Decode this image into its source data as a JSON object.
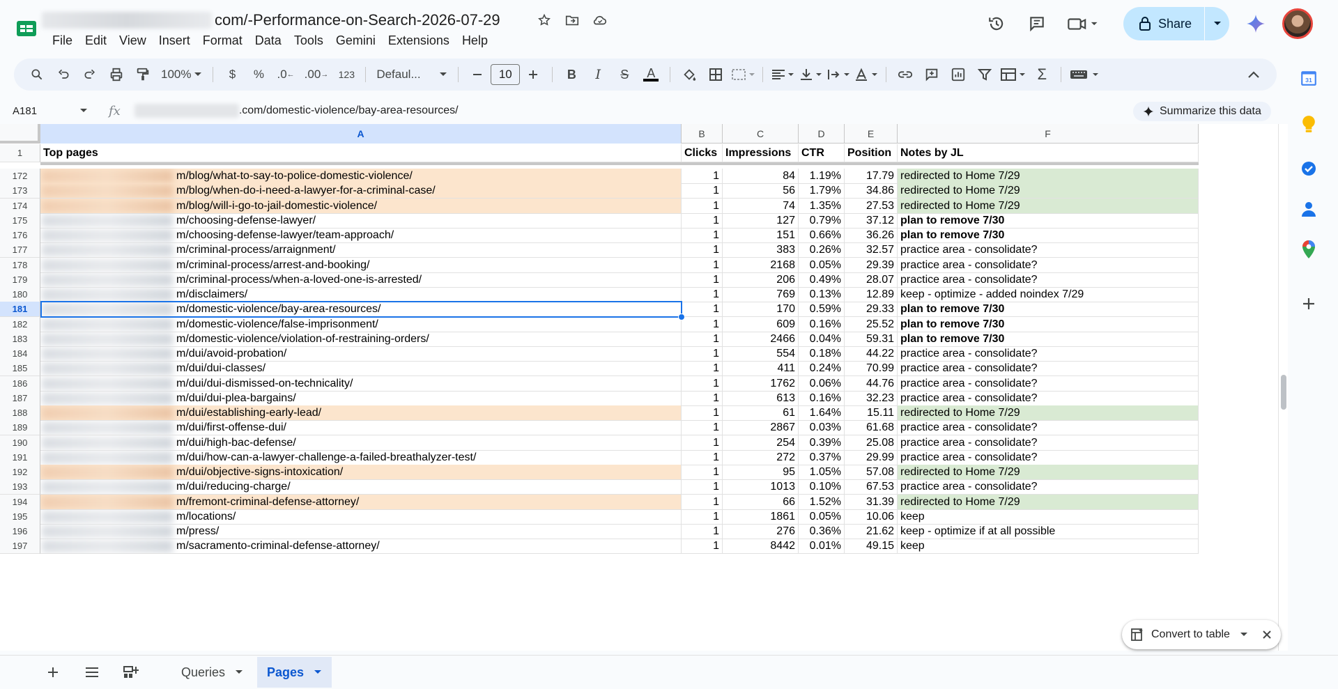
{
  "app": {
    "doc_title": "com/-Performance-on-Search-2026-07-29",
    "menu": [
      "File",
      "Edit",
      "View",
      "Insert",
      "Format",
      "Data",
      "Tools",
      "Gemini",
      "Extensions",
      "Help"
    ],
    "share_label": "Share"
  },
  "toolbar": {
    "zoom": "100%",
    "currency": "$",
    "percent": "%",
    "dec_decrease": ".0",
    "dec_increase": ".00",
    "number_format": "123",
    "font_family": "Defaul...",
    "font_size": "10"
  },
  "formula_bar": {
    "cell_ref": "A181",
    "fx": "fx",
    "content": ".com/domestic-violence/bay-area-resources/",
    "summarize_label": "Summarize this data"
  },
  "columns": [
    "A",
    "B",
    "C",
    "D",
    "E",
    "F"
  ],
  "header_row": {
    "num": "1",
    "cells": [
      "Top pages",
      "Clicks",
      "Impressions",
      "CTR",
      "Position",
      "Notes by JL"
    ]
  },
  "rows": [
    {
      "num": "172",
      "url": "m/blog/what-to-say-to-police-domestic-violence/",
      "clicks": "1",
      "impressions": "84",
      "ctr": "1.19%",
      "position": "17.79",
      "note": "redirected to Home 7/29",
      "style": "redirect"
    },
    {
      "num": "173",
      "url": "m/blog/when-do-i-need-a-lawyer-for-a-criminal-case/",
      "clicks": "1",
      "impressions": "56",
      "ctr": "1.79%",
      "position": "34.86",
      "note": "redirected to Home 7/29",
      "style": "redirect"
    },
    {
      "num": "174",
      "url": "m/blog/will-i-go-to-jail-domestic-violence/",
      "clicks": "1",
      "impressions": "74",
      "ctr": "1.35%",
      "position": "27.53",
      "note": "redirected to Home 7/29",
      "style": "redirect"
    },
    {
      "num": "175",
      "url": "m/choosing-defense-lawyer/",
      "clicks": "1",
      "impressions": "127",
      "ctr": "0.79%",
      "position": "37.12",
      "note": "plan to remove 7/30",
      "style": "remove"
    },
    {
      "num": "176",
      "url": "m/choosing-defense-lawyer/team-approach/",
      "clicks": "1",
      "impressions": "151",
      "ctr": "0.66%",
      "position": "36.26",
      "note": "plan to remove 7/30",
      "style": "remove"
    },
    {
      "num": "177",
      "url": "m/criminal-process/arraignment/",
      "clicks": "1",
      "impressions": "383",
      "ctr": "0.26%",
      "position": "32.57",
      "note": "practice area - consolidate?",
      "style": "plain"
    },
    {
      "num": "178",
      "url": "m/criminal-process/arrest-and-booking/",
      "clicks": "1",
      "impressions": "2168",
      "ctr": "0.05%",
      "position": "29.39",
      "note": "practice area - consolidate?",
      "style": "plain"
    },
    {
      "num": "179",
      "url": "m/criminal-process/when-a-loved-one-is-arrested/",
      "clicks": "1",
      "impressions": "206",
      "ctr": "0.49%",
      "position": "28.07",
      "note": "practice area - consolidate?",
      "style": "plain"
    },
    {
      "num": "180",
      "url": "m/disclaimers/",
      "clicks": "1",
      "impressions": "769",
      "ctr": "0.13%",
      "position": "12.89",
      "note": "keep - optimize - added noindex 7/29",
      "style": "plain"
    },
    {
      "num": "181",
      "url": "m/domestic-violence/bay-area-resources/",
      "clicks": "1",
      "impressions": "170",
      "ctr": "0.59%",
      "position": "29.33",
      "note": "plan to remove 7/30",
      "style": "remove"
    },
    {
      "num": "182",
      "url": "m/domestic-violence/false-imprisonment/",
      "clicks": "1",
      "impressions": "609",
      "ctr": "0.16%",
      "position": "25.52",
      "note": "plan to remove 7/30",
      "style": "remove"
    },
    {
      "num": "183",
      "url": "m/domestic-violence/violation-of-restraining-orders/",
      "clicks": "1",
      "impressions": "2466",
      "ctr": "0.04%",
      "position": "59.31",
      "note": "plan to remove 7/30",
      "style": "remove"
    },
    {
      "num": "184",
      "url": "m/dui/avoid-probation/",
      "clicks": "1",
      "impressions": "554",
      "ctr": "0.18%",
      "position": "44.22",
      "note": "practice area - consolidate?",
      "style": "plain"
    },
    {
      "num": "185",
      "url": "m/dui/dui-classes/",
      "clicks": "1",
      "impressions": "411",
      "ctr": "0.24%",
      "position": "70.99",
      "note": "practice area - consolidate?",
      "style": "plain"
    },
    {
      "num": "186",
      "url": "m/dui/dui-dismissed-on-technicality/",
      "clicks": "1",
      "impressions": "1762",
      "ctr": "0.06%",
      "position": "44.76",
      "note": "practice area - consolidate?",
      "style": "plain"
    },
    {
      "num": "187",
      "url": "m/dui/dui-plea-bargains/",
      "clicks": "1",
      "impressions": "613",
      "ctr": "0.16%",
      "position": "32.23",
      "note": "practice area - consolidate?",
      "style": "plain"
    },
    {
      "num": "188",
      "url": "m/dui/establishing-early-lead/",
      "clicks": "1",
      "impressions": "61",
      "ctr": "1.64%",
      "position": "15.11",
      "note": "redirected to Home 7/29",
      "style": "redirect"
    },
    {
      "num": "189",
      "url": "m/dui/first-offense-dui/",
      "clicks": "1",
      "impressions": "2867",
      "ctr": "0.03%",
      "position": "61.68",
      "note": "practice area - consolidate?",
      "style": "plain"
    },
    {
      "num": "190",
      "url": "m/dui/high-bac-defense/",
      "clicks": "1",
      "impressions": "254",
      "ctr": "0.39%",
      "position": "25.08",
      "note": "practice area - consolidate?",
      "style": "plain"
    },
    {
      "num": "191",
      "url": "m/dui/how-can-a-lawyer-challenge-a-failed-breathalyzer-test/",
      "clicks": "1",
      "impressions": "272",
      "ctr": "0.37%",
      "position": "29.99",
      "note": "practice area - consolidate?",
      "style": "plain"
    },
    {
      "num": "192",
      "url": "m/dui/objective-signs-intoxication/",
      "clicks": "1",
      "impressions": "95",
      "ctr": "1.05%",
      "position": "57.08",
      "note": "redirected to Home 7/29",
      "style": "redirect"
    },
    {
      "num": "193",
      "url": "m/dui/reducing-charge/",
      "clicks": "1",
      "impressions": "1013",
      "ctr": "0.10%",
      "position": "67.53",
      "note": "practice area - consolidate?",
      "style": "plain"
    },
    {
      "num": "194",
      "url": "m/fremont-criminal-defense-attorney/",
      "clicks": "1",
      "impressions": "66",
      "ctr": "1.52%",
      "position": "31.39",
      "note": "redirected to Home 7/29",
      "style": "redirect"
    },
    {
      "num": "195",
      "url": "m/locations/",
      "clicks": "1",
      "impressions": "1861",
      "ctr": "0.05%",
      "position": "10.06",
      "note": "keep",
      "style": "plain"
    },
    {
      "num": "196",
      "url": "m/press/",
      "clicks": "1",
      "impressions": "276",
      "ctr": "0.36%",
      "position": "21.62",
      "note": "keep - optimize if at all possible",
      "style": "plain"
    },
    {
      "num": "197",
      "url": "m/sacramento-criminal-defense-attorney/",
      "clicks": "1",
      "impressions": "8442",
      "ctr": "0.01%",
      "position": "49.15",
      "note": "keep",
      "style": "plain"
    }
  ],
  "convert_table": {
    "label": "Convert to table"
  },
  "sheets": [
    {
      "name": "Queries",
      "active": false
    },
    {
      "name": "Pages",
      "active": true
    }
  ],
  "colors": {
    "redirect_url_bg": "#fce5cd",
    "redirect_note_bg": "#d9ead3",
    "selection": "#1a73e8",
    "share_bg": "#c2e7ff"
  }
}
